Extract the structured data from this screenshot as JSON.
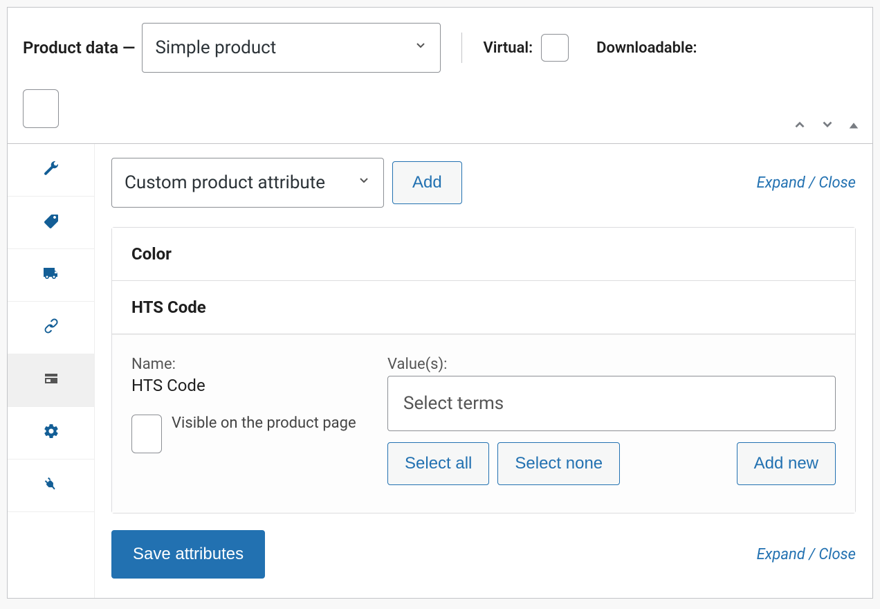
{
  "header": {
    "title": "Product data —",
    "product_type": "Simple product",
    "virtual_label": "Virtual:",
    "downloadable_label": "Downloadable:"
  },
  "toolbar": {
    "attribute_select": "Custom product attribute",
    "add_label": "Add",
    "expand_label": "Expand",
    "close_label": "Close"
  },
  "attributes": [
    {
      "title": "Color"
    },
    {
      "title": "HTS Code",
      "name_label": "Name:",
      "name_value": "HTS Code",
      "visible_label": "Visible on the product page",
      "values_label": "Value(s):",
      "values_placeholder": "Select terms",
      "select_all": "Select all",
      "select_none": "Select none",
      "add_new": "Add new"
    }
  ],
  "footer": {
    "save_label": "Save attributes",
    "expand_label": "Expand",
    "close_label": "Close"
  }
}
